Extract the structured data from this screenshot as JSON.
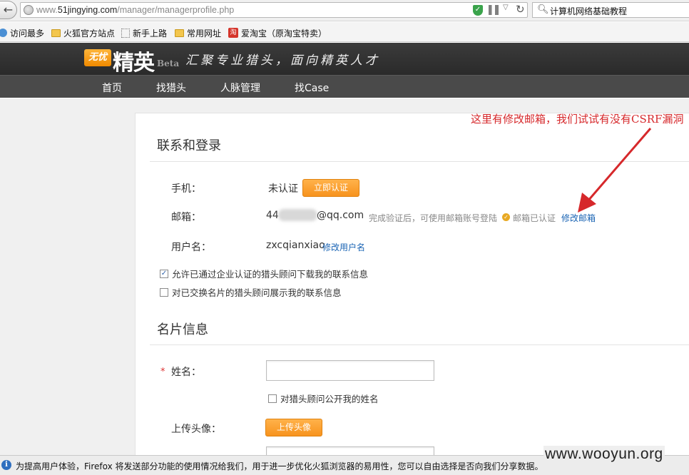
{
  "browser": {
    "url_prefix": "www.",
    "url_host": "51jingying.com",
    "url_path": "/manager/managerprofile.php",
    "search_query": "计算机网络基础教程",
    "bookmarks": [
      {
        "label": "访问最多",
        "icon": "gear-icon"
      },
      {
        "label": "火狐官方站点",
        "icon": "folder-icon"
      },
      {
        "label": "新手上路",
        "icon": "page-icon"
      },
      {
        "label": "常用网址",
        "icon": "folder-icon"
      },
      {
        "label": "爱淘宝（原淘宝特卖）",
        "icon": "taobao-icon"
      }
    ],
    "taobao_glyph": "淘"
  },
  "site": {
    "logo_badge": "无忧",
    "logo_text": "精英",
    "logo_beta": "Beta",
    "slogan": "汇聚专业猎头，面向精英人才",
    "nav": [
      "首页",
      "找猎头",
      "人脉管理",
      "找Case"
    ]
  },
  "contact_section": {
    "title": "联系和登录",
    "phone_label": "手机：",
    "phone_value": "未认证",
    "phone_button": "立即认证",
    "email_label": "邮箱：",
    "email_prefix": "44",
    "email_suffix": "@qq.com",
    "email_hint": "完成验证后，可使用邮箱账号登陆",
    "email_verified": "邮箱已认证",
    "email_edit_link": "修改邮箱",
    "username_label": "用户名：",
    "username_value": "zxcqianxiao",
    "username_edit_link": "修改用户名",
    "checkbox_1": {
      "label": "允许已通过企业认证的猎头顾问下载我的联系信息",
      "checked": true
    },
    "checkbox_2": {
      "label": "对已交换名片的猎头顾问展示我的联系信息",
      "checked": false
    }
  },
  "card_section": {
    "title": "名片信息",
    "name_label": "姓名：",
    "name_value": "",
    "name_public_checkbox": {
      "label": "对猎头顾问公开我的姓名",
      "checked": false
    },
    "avatar_label": "上传头像：",
    "avatar_button": "上传头像"
  },
  "annotation": {
    "text": "这里有修改邮箱，我们试试有没有CSRF漏洞",
    "color": "#d6282b"
  },
  "notification": {
    "text": "为提高用户体验，Firefox 将发送部分功能的使用情况给我们，用于进一步优化火狐浏览器的易用性，您可以自由选择是否向我们分享数据。"
  },
  "watermark": "www.wooyun.org",
  "colors": {
    "accent_orange": "#f7931e",
    "link_blue": "#1a64b4",
    "header_dark": "#2f2f2f"
  }
}
